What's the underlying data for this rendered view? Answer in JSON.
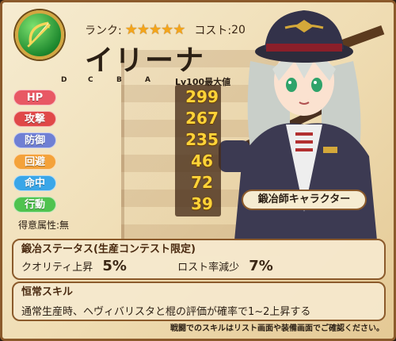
{
  "header": {
    "rank_label": "ランク:",
    "stars": "★★★★★",
    "cost_label": "コスト:",
    "cost_value": "20",
    "name": "イリーナ"
  },
  "grades": [
    "D",
    "C",
    "B",
    "A"
  ],
  "stats_header": "Lv100最大値",
  "stats": [
    {
      "label": "HP",
      "value": "299",
      "fraction": 0.92,
      "color": "#e85864",
      "bar": "#f08a92"
    },
    {
      "label": "攻撃",
      "value": "267",
      "fraction": 0.86,
      "color": "#e04848",
      "bar": "#ee7a7a"
    },
    {
      "label": "防御",
      "value": "235",
      "fraction": 0.8,
      "color": "#6f7fd4",
      "bar": "#8f9ee6"
    },
    {
      "label": "回避",
      "value": "46",
      "fraction": 0.38,
      "color": "#f4a23a",
      "bar": "#f7c070"
    },
    {
      "label": "命中",
      "value": "72",
      "fraction": 0.62,
      "color": "#3aa6e8",
      "bar": "#6cc3f2"
    },
    {
      "label": "行動",
      "value": "39",
      "fraction": 0.34,
      "color": "#4fc34f",
      "bar": "#7ad67a"
    }
  ],
  "tokui": "得意属性:無",
  "tag": "鍛冶師キャラクター",
  "production": {
    "title": "鍛冶ステータス(生産コンテスト限定)",
    "quality_label": "クオリティ上昇",
    "quality_value": "5%",
    "lost_label": "ロスト率減少",
    "lost_value": "7%"
  },
  "skill": {
    "title": "恒常スキル",
    "text": "通常生産時、ヘヴィバリスタと棍の評価が確率で1~2上昇する"
  },
  "note": "戦闘でのスキルはリスト画面や装備画面でご確認ください。",
  "colors": {
    "accent": "#8b5a2b",
    "value": "#ffd338"
  },
  "icons": {
    "emblem": "bow-icon"
  }
}
